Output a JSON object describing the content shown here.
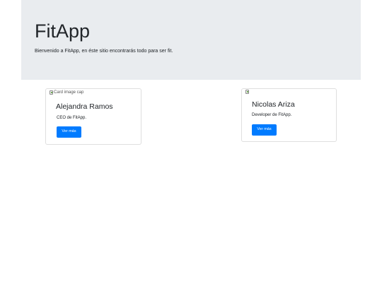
{
  "header": {
    "title": "FitApp",
    "subtitle": "Bienvenido a FitApp, en éste sitio encontrarás todo para ser fit."
  },
  "cards": [
    {
      "image_alt": "Card image cap",
      "name": "Alejandra Ramos",
      "role": "CEO de FitApp.",
      "button_label": "Ver más"
    },
    {
      "image_alt": "",
      "name": "Nicolas Ariza",
      "role": "Developer de FitApp.",
      "button_label": "Ver más"
    }
  ],
  "colors": {
    "jumbotron_bg": "#e9ecef",
    "primary_button": "#007bff"
  },
  "icons": {
    "broken_image": "broken-image-icon"
  }
}
